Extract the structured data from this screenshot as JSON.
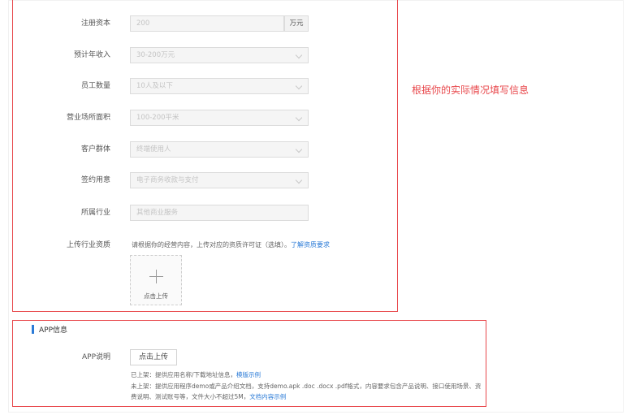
{
  "form": {
    "registered_capital": {
      "label": "注册资本",
      "value": "200",
      "unit": "万元"
    },
    "annual_revenue": {
      "label": "预计年收入",
      "value": "30-200万元"
    },
    "employee_count": {
      "label": "员工数量",
      "value": "10人及以下"
    },
    "business_area": {
      "label": "营业场所面积",
      "value": "100-200平米"
    },
    "customer_group": {
      "label": "客户群体",
      "value": "终端使用人"
    },
    "contract_purpose": {
      "label": "签约用意",
      "value": "电子商务收款与支付"
    },
    "industry": {
      "label": "所属行业",
      "value": "其他商业服务"
    },
    "qualification": {
      "label": "上传行业资质",
      "hint": "请根据你的经营内容，上传对应的资质许可证（选填）。",
      "hint_link": "了解资质要求",
      "upload_label": "点击上传"
    }
  },
  "annotation": "根据你的实际情况填写信息",
  "app_section": {
    "title": "APP信息",
    "app_desc_label": "APP说明",
    "upload_button": "点击上传",
    "note1": "已上架：提供应用名称/下载地址信息，",
    "note1_link": "模版示例",
    "note2": "未上架：提供应用程序demo或产品介绍文档，支持demo.apk .doc .docx .pdf格式，内容要求包含产品说明、接口使用场景、资费说明、测试账号等，文件大小不超过5M，",
    "note2_link": "文档内容示例"
  },
  "colors": {
    "annotation_red": "#e8474b",
    "link_blue": "#2b7bd7"
  }
}
